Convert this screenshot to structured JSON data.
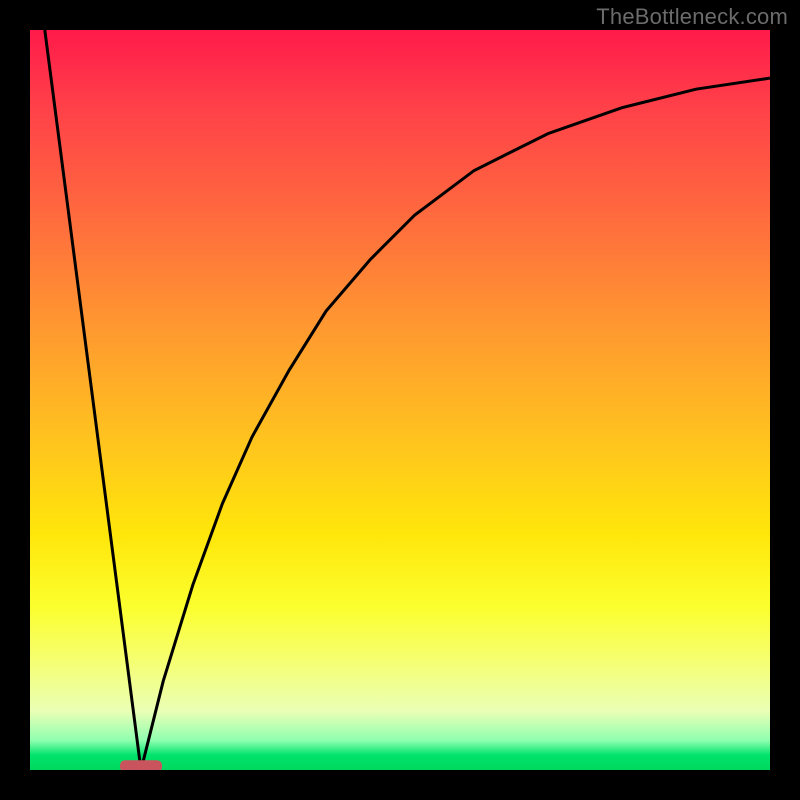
{
  "watermark": {
    "text": "TheBottleneck.com"
  },
  "chart_data": {
    "type": "line",
    "title": "",
    "xlabel": "",
    "ylabel": "",
    "xlim": [
      0,
      100
    ],
    "ylim": [
      0,
      100
    ],
    "grid": false,
    "legend": false,
    "background_gradient": {
      "stops": [
        {
          "pos": 0,
          "color": "#ff1a4a"
        },
        {
          "pos": 25,
          "color": "#ff6a3e"
        },
        {
          "pos": 55,
          "color": "#ffc21f"
        },
        {
          "pos": 78,
          "color": "#fbff2e"
        },
        {
          "pos": 96,
          "color": "#8fffb0"
        },
        {
          "pos": 100,
          "color": "#00d85f"
        }
      ]
    },
    "optimum_marker": {
      "x": 15,
      "y": 0.5,
      "color": "#c9545e"
    },
    "series": [
      {
        "name": "left-branch",
        "x": [
          2,
          15
        ],
        "y": [
          100,
          0
        ]
      },
      {
        "name": "right-branch",
        "x": [
          15,
          18,
          22,
          26,
          30,
          35,
          40,
          46,
          52,
          60,
          70,
          80,
          90,
          100
        ],
        "y": [
          0,
          12,
          25,
          36,
          45,
          54,
          62,
          69,
          75,
          81,
          86,
          89.5,
          92,
          93.5
        ]
      }
    ]
  }
}
